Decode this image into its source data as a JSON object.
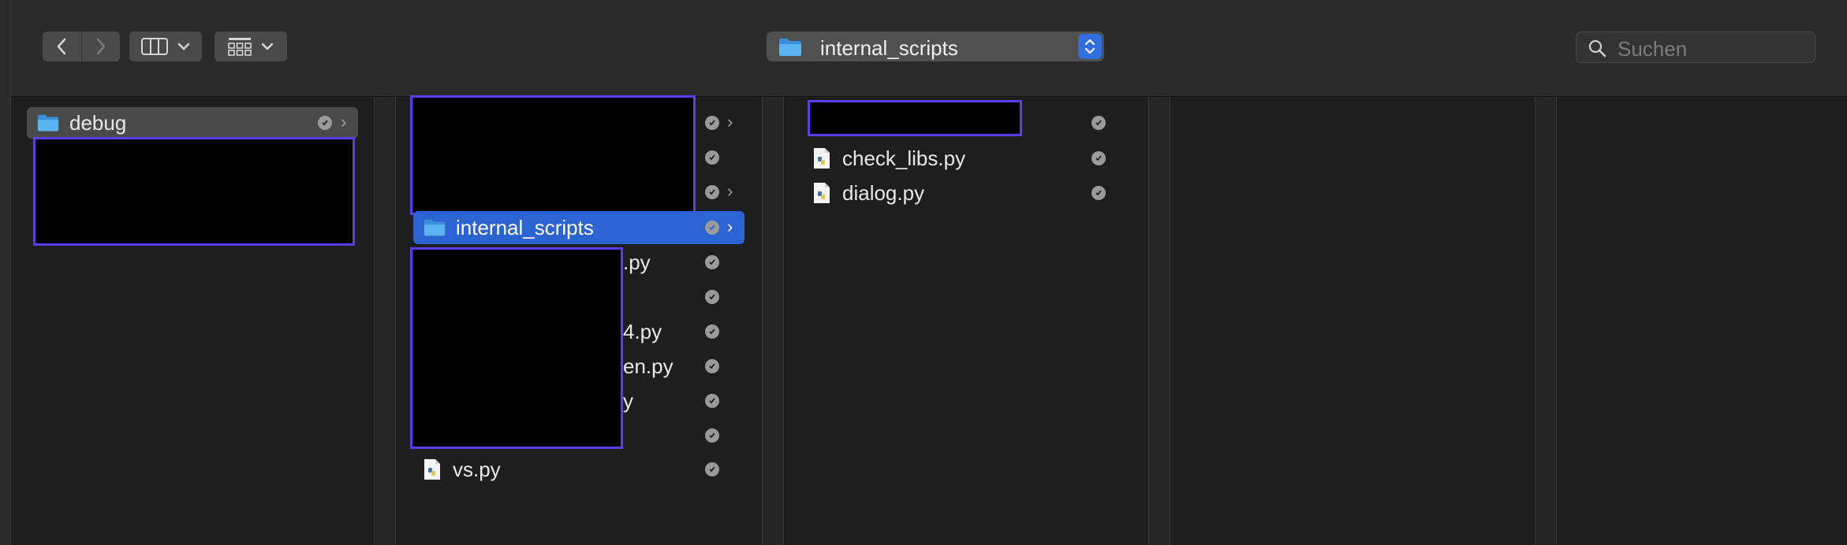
{
  "toolbar": {
    "back": "back",
    "forward": "forward",
    "view_mode": "column-view",
    "group_mode": "group-view",
    "path_popup": {
      "label": "internal_scripts"
    },
    "search": {
      "placeholder": "Suchen"
    }
  },
  "columns": {
    "col1": {
      "items": [
        {
          "label": "debug",
          "type": "folder",
          "selected": true
        }
      ]
    },
    "col2": {
      "items": [
        {
          "label": "internal_scripts",
          "type": "folder",
          "selected": true
        },
        {
          "label": ".py",
          "type": "partial"
        },
        {
          "label": "4.py",
          "type": "partial"
        },
        {
          "label": "en.py",
          "type": "partial"
        },
        {
          "label": "y",
          "type": "partial"
        },
        {
          "label": "vs.py",
          "type": "python"
        }
      ]
    },
    "col3": {
      "items": [
        {
          "label": "check_libs.py",
          "type": "python"
        },
        {
          "label": "dialog.py",
          "type": "python"
        }
      ]
    }
  },
  "colors": {
    "accent": "#2c63d2",
    "redaction_border": "#5a3ee8",
    "folder": "#4aa3ea"
  }
}
